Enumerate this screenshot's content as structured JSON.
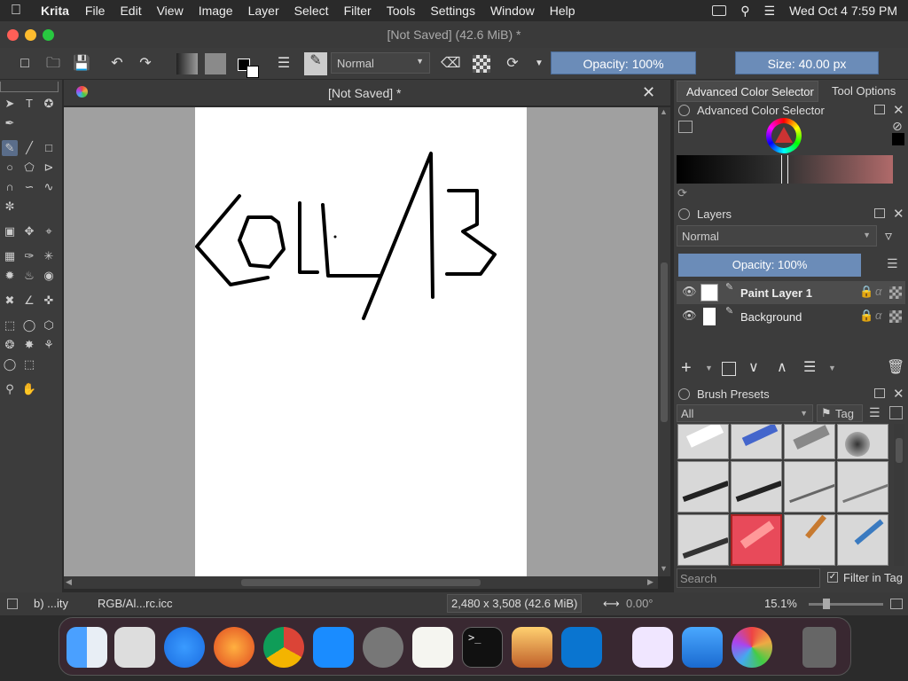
{
  "menubar": {
    "app_name": "Krita",
    "items": [
      "File",
      "Edit",
      "View",
      "Image",
      "Layer",
      "Select",
      "Filter",
      "Tools",
      "Settings",
      "Window",
      "Help"
    ],
    "clock": "Wed Oct 4  7:59 PM"
  },
  "window": {
    "title": "[Not Saved]  (42.6 MiB)  *"
  },
  "toolbar": {
    "blend_mode": "Normal",
    "opacity_label": "Opacity: 100%",
    "size_label": "Size: 40.00 px"
  },
  "document": {
    "tab_title": "[Not Saved]  *"
  },
  "dock": {
    "tabs": [
      "Advanced Color Selector",
      "Tool Options"
    ],
    "color_selector_title": "Advanced Color Selector",
    "layers_title": "Layers",
    "layers_blend": "Normal",
    "layers_opacity": "Opacity:  100%",
    "layers": [
      {
        "name": "Paint Layer 1"
      },
      {
        "name": "Background"
      }
    ],
    "brush_presets_title": "Brush Presets",
    "brush_filter": "All",
    "tag_label": "Tag",
    "search_placeholder": "Search",
    "filter_in_tag": "Filter in Tag"
  },
  "statusbar": {
    "brush": "b) ...ity",
    "color_profile": "RGB/Al...rc.icc",
    "dimensions": "2,480 x 3,508 (42.6 MiB)",
    "rotation": "0.00°",
    "zoom": "15.1%"
  },
  "colors": {
    "accent_blue": "#6b8cb8",
    "selected_brush": "#e84a5a"
  }
}
